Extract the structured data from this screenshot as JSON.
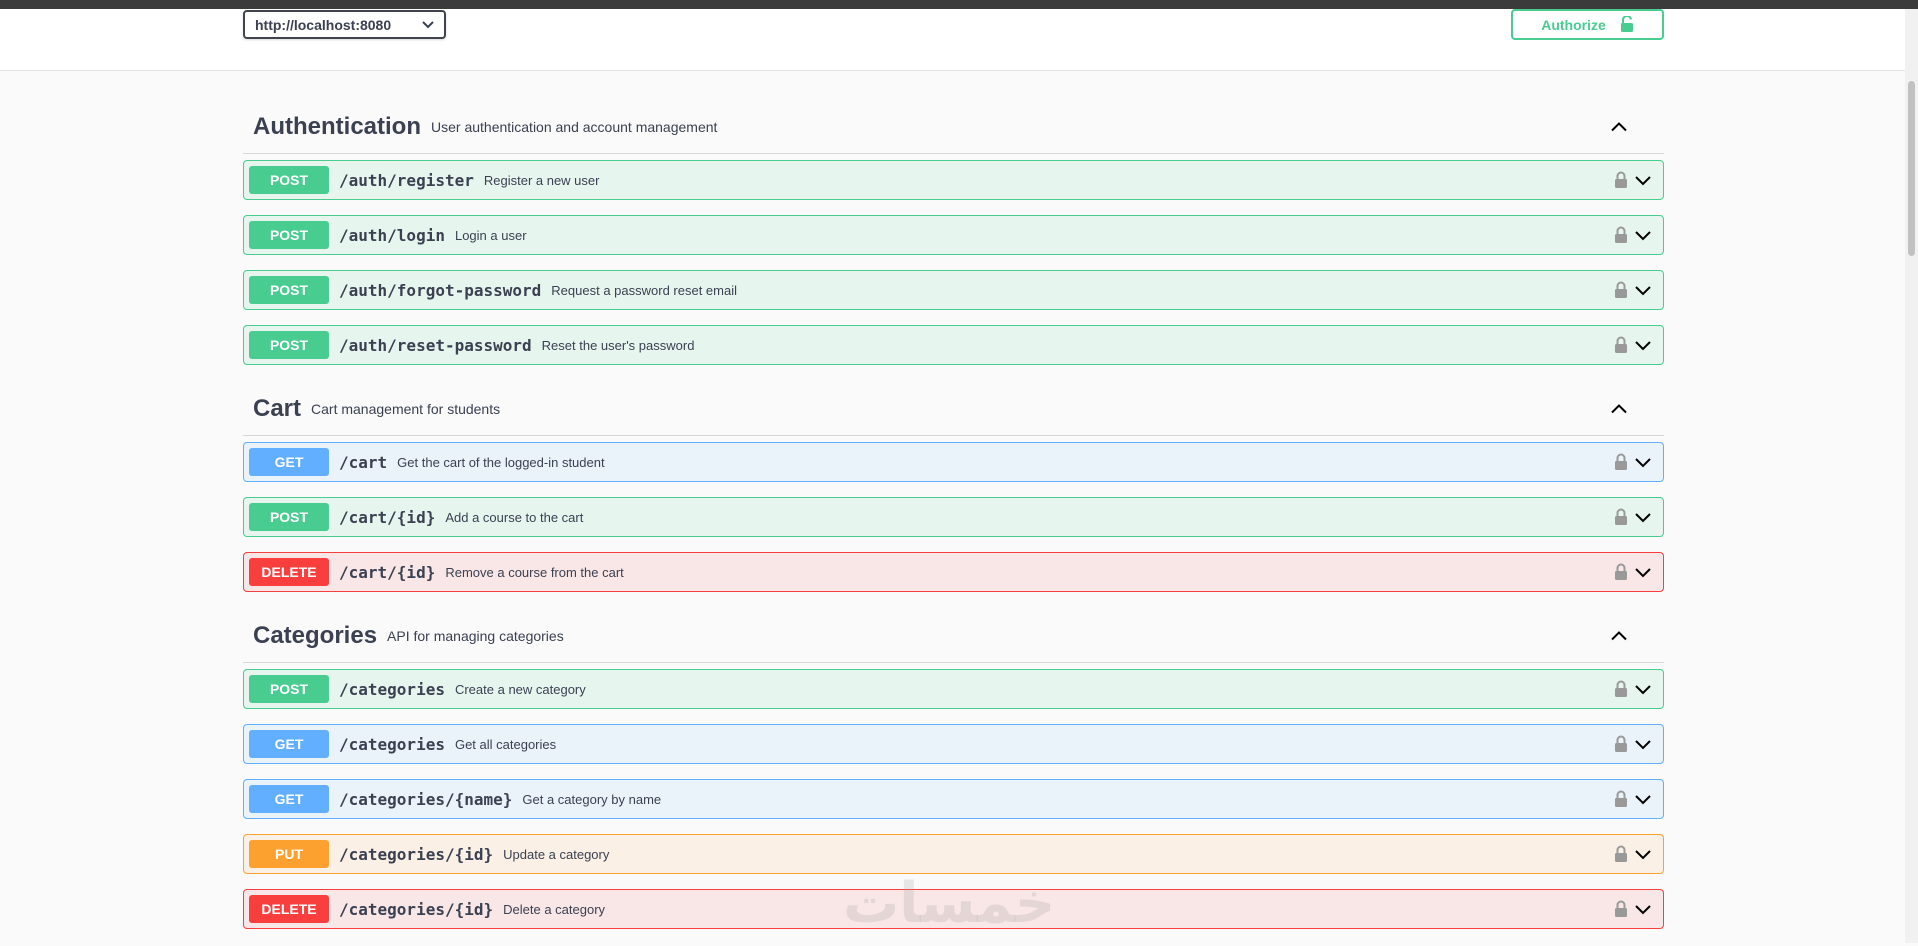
{
  "header": {
    "server_url": "http://localhost:8080",
    "authorize_label": "Authorize"
  },
  "tags": [
    {
      "name": "Authentication",
      "description": "User authentication and account management",
      "ops": [
        {
          "method": "POST",
          "path": "/auth/register",
          "summary": "Register a new user"
        },
        {
          "method": "POST",
          "path": "/auth/login",
          "summary": "Login a user"
        },
        {
          "method": "POST",
          "path": "/auth/forgot-password",
          "summary": "Request a password reset email"
        },
        {
          "method": "POST",
          "path": "/auth/reset-password",
          "summary": "Reset the user's password"
        }
      ]
    },
    {
      "name": "Cart",
      "description": "Cart management for students",
      "ops": [
        {
          "method": "GET",
          "path": "/cart",
          "summary": "Get the cart of the logged-in student"
        },
        {
          "method": "POST",
          "path": "/cart/{id}",
          "summary": "Add a course to the cart"
        },
        {
          "method": "DELETE",
          "path": "/cart/{id}",
          "summary": "Remove a course from the cart"
        }
      ]
    },
    {
      "name": "Categories",
      "description": "API for managing categories",
      "ops": [
        {
          "method": "POST",
          "path": "/categories",
          "summary": "Create a new category"
        },
        {
          "method": "GET",
          "path": "/categories",
          "summary": "Get all categories"
        },
        {
          "method": "GET",
          "path": "/categories/{name}",
          "summary": "Get a category by name"
        },
        {
          "method": "PUT",
          "path": "/categories/{id}",
          "summary": "Update a category"
        },
        {
          "method": "DELETE",
          "path": "/categories/{id}",
          "summary": "Delete a category"
        }
      ]
    }
  ],
  "watermark": "خمسات",
  "colors": {
    "post": "#49cc90",
    "get": "#61affe",
    "delete": "#f93e3e",
    "put": "#fca130"
  }
}
